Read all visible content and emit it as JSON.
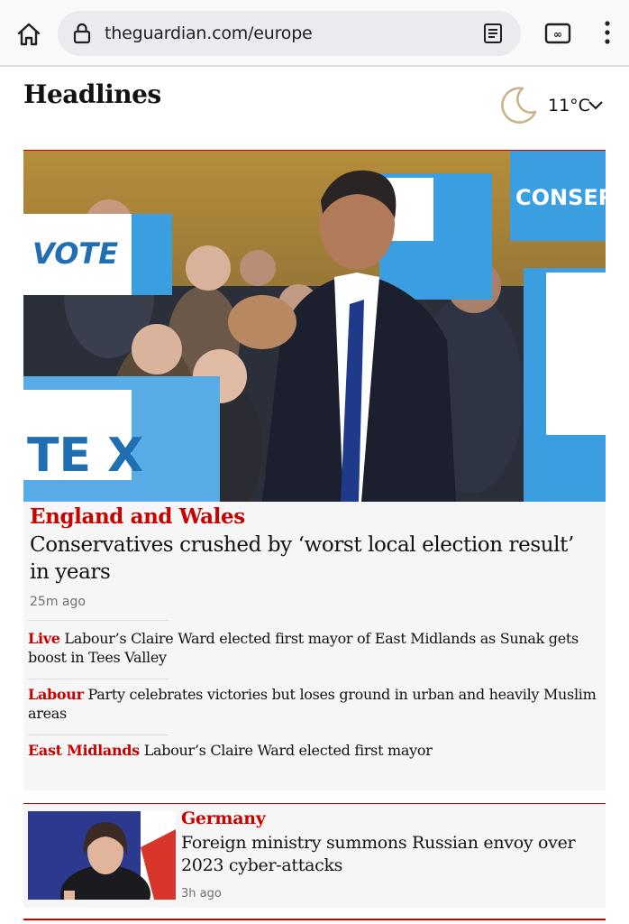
{
  "browser": {
    "url": "theguardian.com/europe",
    "icons": [
      "home-icon",
      "lock-icon",
      "reader-mode-icon",
      "tab-switcher-icon",
      "overflow-menu-icon"
    ]
  },
  "section": {
    "title": "Headlines",
    "weather": {
      "temperature": "11°C",
      "icon": "moon-icon"
    }
  },
  "lead_story": {
    "kicker": "England and Wales",
    "headline": "Conservatives crushed by ‘worst local election result’ in years",
    "age": "25m ago",
    "sublinks": [
      {
        "kicker": "Live",
        "text": "Labour’s Claire Ward elected first mayor of East Midlands as Sunak gets boost in Tees Valley"
      },
      {
        "kicker": "Labour",
        "text": "Party celebrates victories but loses ground in urban and heavily Muslim areas"
      },
      {
        "kicker": "East Midlands",
        "text": "Labour’s Claire Ward elected first mayor"
      }
    ],
    "image_signs": [
      "VOTE",
      "TE X",
      "CONSER"
    ]
  },
  "second_story": {
    "kicker": "Germany",
    "headline": "Foreign ministry summons Russian envoy over 2023 cyber-attacks",
    "age": "3h ago"
  },
  "colors": {
    "accent": "#c70000",
    "card_bg": "#f6f6f6",
    "sign_blue": "#3b9ee0"
  }
}
